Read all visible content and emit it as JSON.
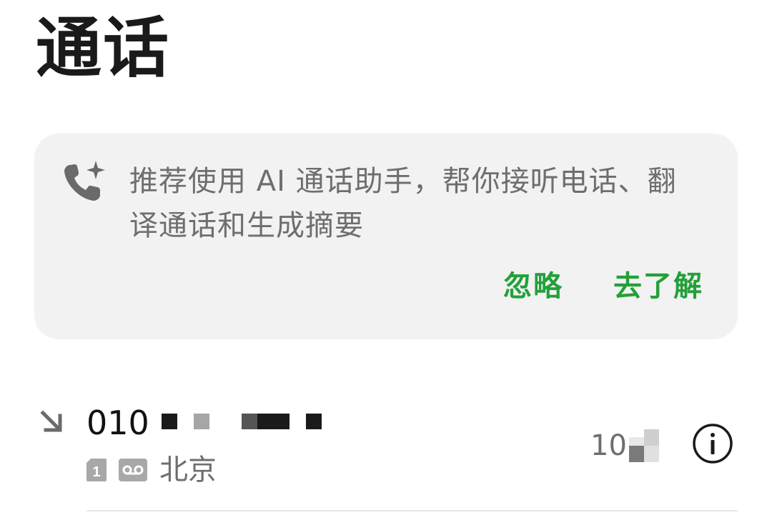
{
  "page": {
    "title": "通话"
  },
  "suggestion_card": {
    "icon": "phone-sparkle-icon",
    "message": "推荐使用 AI 通话助手，帮你接听电话、翻译通话和生成摘要",
    "ignore_label": "忽略",
    "learn_more_label": "去了解",
    "accent_color": "#23a03a"
  },
  "call_log": [
    {
      "direction_icon": "incoming-arrow-icon",
      "number_prefix": "010",
      "sim_label": "1",
      "voicemail_icon": "voicemail-icon",
      "location": "北京",
      "time": "10:"
    }
  ]
}
